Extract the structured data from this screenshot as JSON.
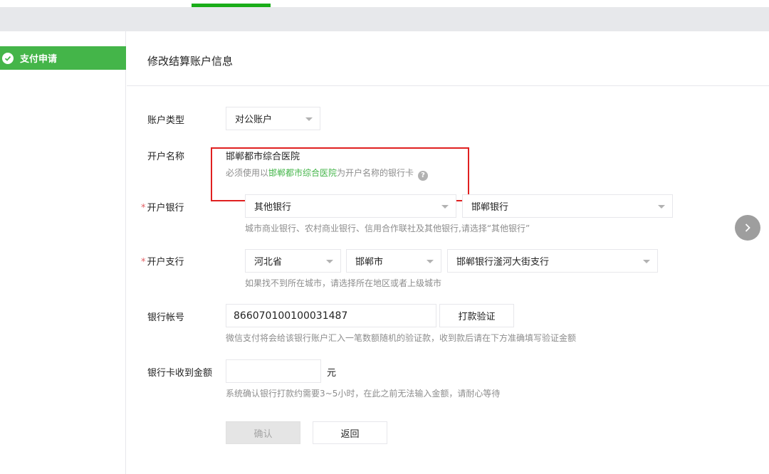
{
  "sidebar": {
    "items": [
      {
        "label": "支付申请",
        "icon": "check-circle-icon"
      }
    ]
  },
  "page": {
    "title": "修改结算账户信息"
  },
  "form": {
    "account_type": {
      "label": "账户类型",
      "value": "对公账户"
    },
    "account_name": {
      "label": "开户名称",
      "value": "邯郸都市综合医院",
      "hint_prefix": "必须使用以",
      "hint_highlight": "邯郸都市综合医院",
      "hint_suffix": "为开户名称的银行卡",
      "help_icon": "?"
    },
    "bank": {
      "required_mark": "*",
      "label": "开户银行",
      "select1": "其他银行",
      "select2": "邯郸银行",
      "hint": "城市商业银行、农村商业银行、信用合作联社及其他银行,请选择“其他银行”"
    },
    "branch": {
      "required_mark": "*",
      "label": "开户支行",
      "province": "河北省",
      "city": "邯郸市",
      "branch_name": "邯郸银行滏河大街支行",
      "hint": "如果找不到所在城市，请选择所在地区或者上级城市"
    },
    "account_number": {
      "label": "银行帐号",
      "value": "866070100100031487",
      "verify_button": "打款验证",
      "hint": "微信支付将会给该银行账户汇入一笔数额随机的验证款，收到款后请在下方准确填写验证金额"
    },
    "amount": {
      "label": "银行卡收到金额",
      "value": "",
      "unit": "元",
      "hint": "系统确认银行打款约需要3~5小时，在此之前无法输入金额，请耐心等待"
    },
    "confirm_button": "确认",
    "back_button": "返回"
  },
  "colors": {
    "accent": "#44b549",
    "highlight_box": "#e02020"
  }
}
